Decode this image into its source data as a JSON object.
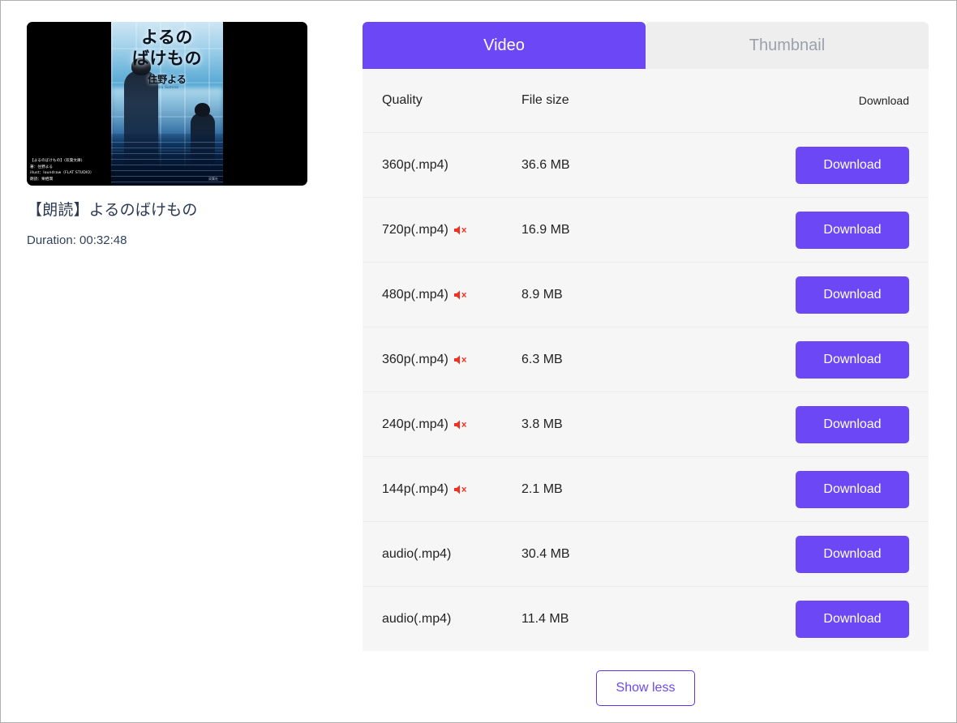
{
  "media": {
    "title": "【朗読】よるのばけもの",
    "duration_label": "Duration: 00:32:48",
    "thumbnail": {
      "cover_title_line1": "よるの",
      "cover_title_line2": "ばけもの",
      "cover_author": "住野よる",
      "cover_author_romaji": "Yoru Sumino",
      "cover_publisher": "双葉社",
      "credits_line1": "【よるのばけもの】(双葉文庫)",
      "credits_line2": "著：住野よる",
      "credits_line3": "illust：loundraw（FLAT STUDIO）",
      "credits_line4": "朗読：栗栖潤"
    }
  },
  "tabs": [
    {
      "label": "Video",
      "active": true
    },
    {
      "label": "Thumbnail",
      "active": false
    }
  ],
  "table": {
    "headers": {
      "quality": "Quality",
      "file_size": "File size",
      "download": "Download"
    },
    "rows": [
      {
        "quality": "360p(.mp4)",
        "muted": false,
        "file_size": "36.6 MB",
        "action": "Download"
      },
      {
        "quality": "720p(.mp4)",
        "muted": true,
        "file_size": "16.9 MB",
        "action": "Download"
      },
      {
        "quality": "480p(.mp4)",
        "muted": true,
        "file_size": "8.9 MB",
        "action": "Download"
      },
      {
        "quality": "360p(.mp4)",
        "muted": true,
        "file_size": "6.3 MB",
        "action": "Download"
      },
      {
        "quality": "240p(.mp4)",
        "muted": true,
        "file_size": "3.8 MB",
        "action": "Download"
      },
      {
        "quality": "144p(.mp4)",
        "muted": true,
        "file_size": "2.1 MB",
        "action": "Download"
      },
      {
        "quality": "audio(.mp4)",
        "muted": false,
        "file_size": "30.4 MB",
        "action": "Download"
      },
      {
        "quality": "audio(.mp4)",
        "muted": false,
        "file_size": "11.4 MB",
        "action": "Download"
      }
    ]
  },
  "footer": {
    "show_less_label": "Show less"
  },
  "icons": {
    "muted_speaker": "muted-speaker-icon"
  },
  "colors": {
    "accent_purple": "#6c47f5",
    "accent_purple_border": "#6233e8",
    "tab_inactive_bg": "#eeeeee",
    "tab_inactive_text": "#9aa1ab",
    "table_bg": "#f6f6f6",
    "row_divider": "#ececec",
    "text_primary": "#232323",
    "title_text": "#2b3a52",
    "mute_red": "#ef3124"
  }
}
